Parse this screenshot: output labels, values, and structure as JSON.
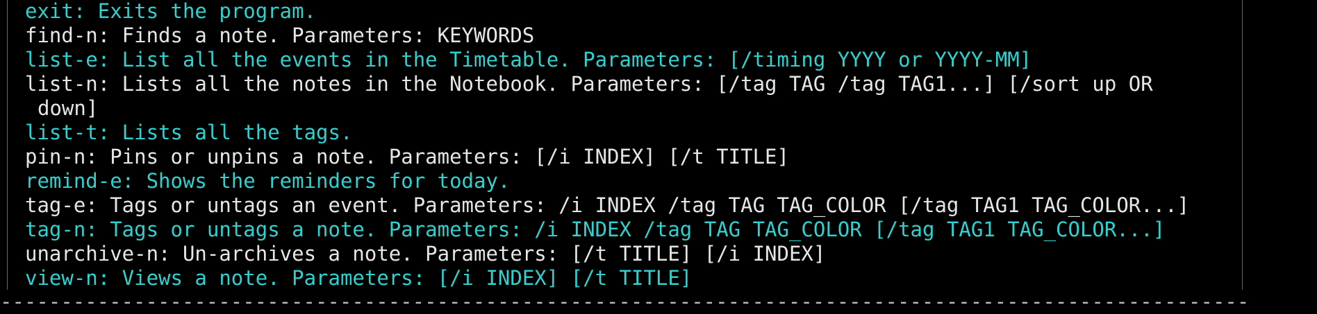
{
  "terminal": {
    "lines": [
      {
        "text": "exit: Exits the program.",
        "color": "#2fd1d1"
      },
      {
        "text": "find-n: Finds a note. Parameters: KEYWORDS",
        "color": "#e6e6e6"
      },
      {
        "text": "list-e: List all the events in the Timetable. Parameters: [/timing YYYY or YYYY-MM]",
        "color": "#2fd1d1"
      },
      {
        "text": "list-n: Lists all the notes in the Notebook. Parameters: [/tag TAG /tag TAG1...] [/sort up OR",
        "color": "#e6e6e6"
      },
      {
        "text": "down]",
        "color": "#e6e6e6"
      },
      {
        "text": "list-t: Lists all the tags.",
        "color": "#2fd1d1"
      },
      {
        "text": "pin-n: Pins or unpins a note. Parameters: [/i INDEX] [/t TITLE]",
        "color": "#e6e6e6"
      },
      {
        "text": "remind-e: Shows the reminders for today.",
        "color": "#2fd1d1"
      },
      {
        "text": "tag-e: Tags or untags an event. Parameters: /i INDEX /tag TAG TAG_COLOR [/tag TAG1 TAG_COLOR...]",
        "color": "#e6e6e6"
      },
      {
        "text": "tag-n: Tags or untags a note. Parameters: /i INDEX /tag TAG TAG_COLOR [/tag TAG1 TAG_COLOR...]",
        "color": "#2fd1d1"
      },
      {
        "text": "unarchive-n: Un-archives a note. Parameters: [/t TITLE] [/i INDEX]",
        "color": "#e6e6e6"
      },
      {
        "text": "view-n: Views a note. Parameters: [/i INDEX] [/t TITLE]",
        "color": "#2fd1d1"
      }
    ],
    "separator": "-----------------------------------------------------------------------------------------------------------------------"
  }
}
